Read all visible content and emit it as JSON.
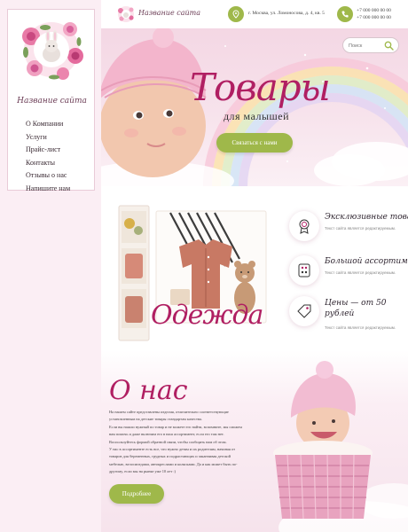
{
  "colors": {
    "accent": "#b01f62",
    "button": "#9fb84a",
    "sidebar_bg": "#fbeef4"
  },
  "sidebar": {
    "logo_icon": "bunny-flower-wreath",
    "site_name": "Название сайта",
    "menu": [
      {
        "label": "О Компании"
      },
      {
        "label": "Услуги"
      },
      {
        "label": "Прайс-лист"
      },
      {
        "label": "Контакты"
      },
      {
        "label": "Отзывы о нас"
      },
      {
        "label": "Напишите нам"
      }
    ]
  },
  "header": {
    "site_name": "Название сайта",
    "address": "г. Москва, ул. Ломоносова, д. 4, кв. 5",
    "phones": [
      "+7 000 000 00 00",
      "+7 000 000 00 00"
    ],
    "address_icon": "location-pin-icon",
    "phone_icon": "phone-icon"
  },
  "search": {
    "placeholder": "Поиск",
    "icon": "search-icon"
  },
  "hero": {
    "title": "Товары",
    "subtitle": "для малышей",
    "button": "Связаться с нами"
  },
  "clothing": {
    "label": "Одежда"
  },
  "features": [
    {
      "icon": "award-badge-icon",
      "title": "Эксклюзивные товары",
      "text": "Текст сайта является редактируемым."
    },
    {
      "icon": "onesie-icon",
      "title": "Большой ассортимент",
      "text": "Текст сайта является редактируемым."
    },
    {
      "icon": "price-tag-icon",
      "title": "Цены — от 50 рублей",
      "text": "Текст сайта является редактируемым."
    }
  ],
  "about": {
    "title": "О нас",
    "paragraphs": [
      "На нашем сайте представлены изделия, отличительно соответствующие",
      "установленным на детские товары стандартам качества.",
      "Если вы нашли нужный по товар и не можете его найти, вспомните, мы сможем",
      "вам помочь и даже включим его в наш ассортимент, если его там нет.",
      "Воспользуйтесь формой обратной связи, чтобы сообщить нам об этом.",
      "У нас в ассортименте есть все, что нужно детям и их родителям, начиная от",
      "товаров для беременных, грудных и подрастающих и заканчивая детской",
      "мебелью, велосипедами, автокреслами и колясками. Да и как может быть по-",
      "другому, если мы на рынке уже 10 лет :)"
    ],
    "button": "Подробнее"
  }
}
